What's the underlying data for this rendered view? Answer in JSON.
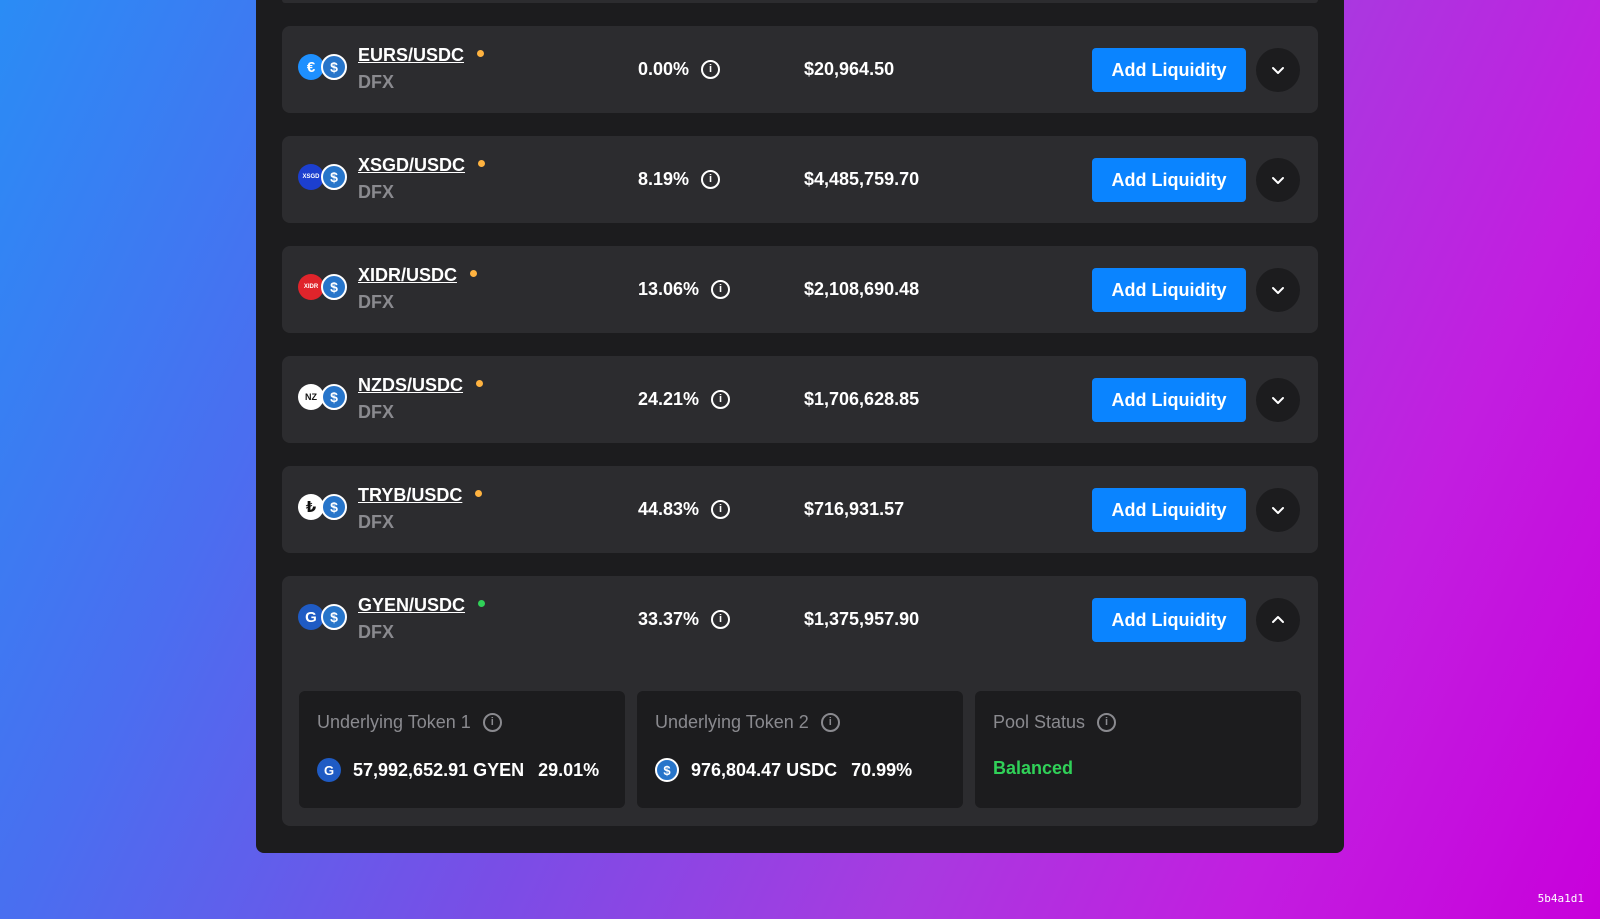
{
  "pools": [
    {
      "pair": "EURS/USDC",
      "platform": "DFX",
      "apr": "0.00%",
      "tvl": "$20,964.50",
      "status_color": "#ffb340",
      "logo_text": "€",
      "logo_bg": "#1e90ff",
      "logo_fg": "#ffffff",
      "expanded": false
    },
    {
      "pair": "XSGD/USDC",
      "platform": "DFX",
      "apr": "8.19%",
      "tvl": "$4,485,759.70",
      "status_color": "#ffb340",
      "logo_text": "XSGD",
      "logo_bg": "#1c3fcf",
      "logo_fg": "#ffffff",
      "expanded": false
    },
    {
      "pair": "XIDR/USDC",
      "platform": "DFX",
      "apr": "13.06%",
      "tvl": "$2,108,690.48",
      "status_color": "#ffb340",
      "logo_text": "XIDR",
      "logo_bg": "#e0242b",
      "logo_fg": "#ffffff",
      "expanded": false
    },
    {
      "pair": "NZDS/USDC",
      "platform": "DFX",
      "apr": "24.21%",
      "tvl": "$1,706,628.85",
      "status_color": "#ffb340",
      "logo_text": "NZ",
      "logo_bg": "#ffffff",
      "logo_fg": "#111111",
      "expanded": false
    },
    {
      "pair": "TRYB/USDC",
      "platform": "DFX",
      "apr": "44.83%",
      "tvl": "$716,931.57",
      "status_color": "#ffb340",
      "logo_text": "₺",
      "logo_bg": "#ffffff",
      "logo_fg": "#111111",
      "expanded": false
    },
    {
      "pair": "GYEN/USDC",
      "platform": "DFX",
      "apr": "33.37%",
      "tvl": "$1,375,957.90",
      "status_color": "#30d158",
      "logo_text": "G",
      "logo_bg": "#1f5bc4",
      "logo_fg": "#ffffff",
      "expanded": true
    }
  ],
  "add_liquidity_label": "Add Liquidity",
  "usdc_logo_text": "$",
  "details": {
    "token1": {
      "title": "Underlying Token 1",
      "amount": "57,992,652.91 GYEN",
      "pct": "29.01%",
      "logo_text": "G",
      "logo_bg": "#1f5bc4"
    },
    "token2": {
      "title": "Underlying Token 2",
      "amount": "976,804.47 USDC",
      "pct": "70.99%",
      "logo_text": "$",
      "logo_bg": "#2775ca"
    },
    "status": {
      "title": "Pool Status",
      "value": "Balanced",
      "color": "#30d158"
    }
  },
  "icons": {
    "info": "info-icon",
    "chevron_down": "chevron-down-icon",
    "chevron_up": "chevron-up-icon"
  },
  "watermark": "5b4a1d1"
}
